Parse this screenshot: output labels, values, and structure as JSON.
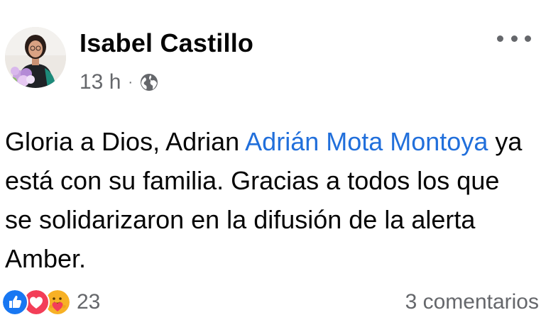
{
  "post": {
    "author": "Isabel Castillo",
    "time": "13 h",
    "separator": "·",
    "privacy_icon": "globe-icon",
    "more_icon": "more-options-icon",
    "text_before_mention": "Gloria a Dios, Adrian ",
    "mention": "Adrián Mota Montoya",
    "text_after_mention": " ya está con su familia. Gracias a todos los que se solidarizaron en la difusión de la alerta Amber."
  },
  "reactions": {
    "icons": [
      "like-icon",
      "love-icon",
      "care-icon"
    ],
    "count": "23"
  },
  "comments": {
    "label": "3 comentarios"
  },
  "colors": {
    "link": "#216fdb",
    "secondary_text": "#65676b",
    "like": "#1877f2",
    "love": "#f33e58",
    "care": "#f7b125"
  }
}
